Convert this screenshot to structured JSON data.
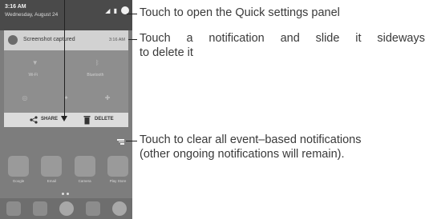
{
  "phone": {
    "status_time": "3:16 AM",
    "status_date": "Wednesday, August 24",
    "status_icons": "⁴⁶⁄ ▮",
    "notification": {
      "title": "Screenshot captured",
      "time": "3:16 AM"
    },
    "quick_settings": {
      "wifi_label": "Wi-Fi",
      "bluetooth_label": "Bluetooth"
    },
    "actions": {
      "share_label": "SHARE",
      "delete_label": "DELETE"
    },
    "apps": [
      {
        "label": "Google"
      },
      {
        "label": "Email"
      },
      {
        "label": "Camera"
      },
      {
        "label": "Play Store"
      }
    ]
  },
  "captions": {
    "quick_settings": "Touch to open the Quick settings panel",
    "notification_line1": "Touch a notification and slide it sideways",
    "notification_line2": "to delete it",
    "clear_line1": "Touch to clear all event–based notifications",
    "clear_line2": "(other ongoing notifications will remain)."
  }
}
